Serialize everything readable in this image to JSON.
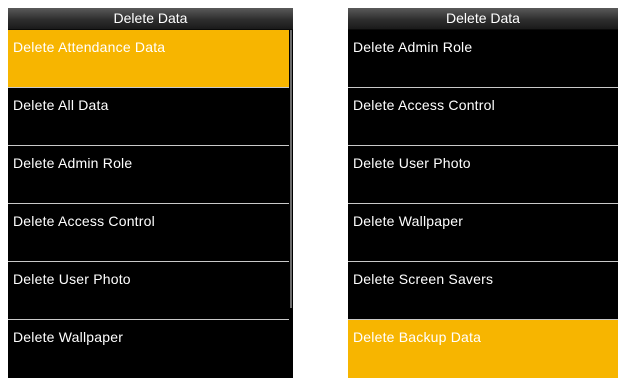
{
  "screens": [
    {
      "title": "Delete Data",
      "items": [
        {
          "label": "Delete Attendance Data",
          "selected": true
        },
        {
          "label": "Delete All Data",
          "selected": false
        },
        {
          "label": "Delete Admin Role",
          "selected": false
        },
        {
          "label": "Delete Access Control",
          "selected": false
        },
        {
          "label": "Delete User Photo",
          "selected": false
        },
        {
          "label": "Delete Wallpaper",
          "selected": false
        }
      ]
    },
    {
      "title": "Delete Data",
      "items": [
        {
          "label": "Delete Admin Role",
          "selected": false
        },
        {
          "label": "Delete Access Control",
          "selected": false
        },
        {
          "label": "Delete User Photo",
          "selected": false
        },
        {
          "label": "Delete Wallpaper",
          "selected": false
        },
        {
          "label": "Delete Screen Savers",
          "selected": false
        },
        {
          "label": "Delete Backup Data",
          "selected": true
        }
      ]
    }
  ],
  "colors": {
    "highlight": "#f7b500",
    "background": "#000000",
    "text": "#ffffff",
    "divider": "#c9c9c9"
  }
}
